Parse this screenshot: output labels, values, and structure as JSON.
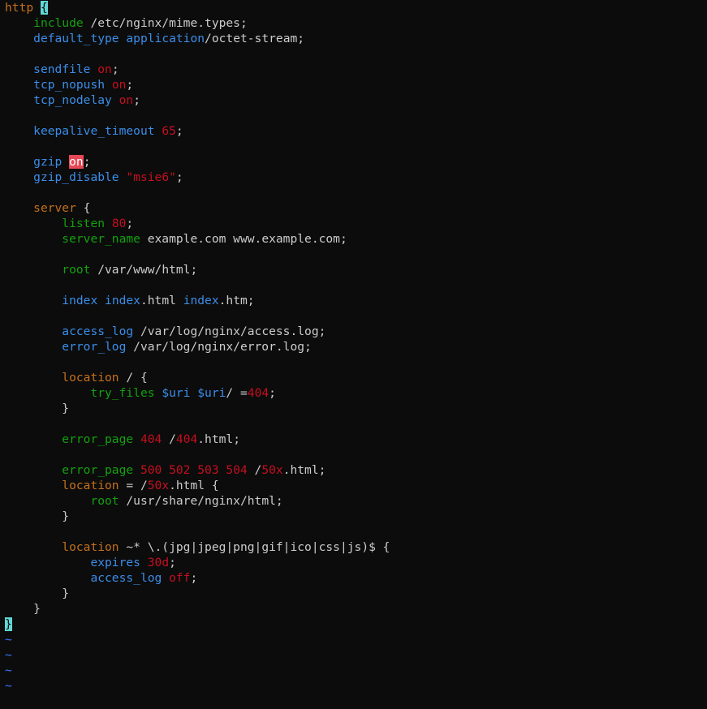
{
  "editor": {
    "lines": [
      [
        {
          "t": "http",
          "c": "block"
        },
        {
          "t": " ",
          "c": "plain"
        },
        {
          "t": "{",
          "c": "cursor"
        }
      ],
      [
        {
          "t": "    ",
          "c": "plain"
        },
        {
          "t": "include",
          "c": "green"
        },
        {
          "t": " /etc/nginx/mime.types;",
          "c": "plain"
        }
      ],
      [
        {
          "t": "    ",
          "c": "plain"
        },
        {
          "t": "default_type",
          "c": "blue"
        },
        {
          "t": " ",
          "c": "plain"
        },
        {
          "t": "application",
          "c": "blue"
        },
        {
          "t": "/octet-stream;",
          "c": "plain"
        }
      ],
      [],
      [
        {
          "t": "    ",
          "c": "plain"
        },
        {
          "t": "sendfile",
          "c": "blue"
        },
        {
          "t": " ",
          "c": "plain"
        },
        {
          "t": "on",
          "c": "red"
        },
        {
          "t": ";",
          "c": "plain"
        }
      ],
      [
        {
          "t": "    ",
          "c": "plain"
        },
        {
          "t": "tcp_nopush",
          "c": "blue"
        },
        {
          "t": " ",
          "c": "plain"
        },
        {
          "t": "on",
          "c": "red"
        },
        {
          "t": ";",
          "c": "plain"
        }
      ],
      [
        {
          "t": "    ",
          "c": "plain"
        },
        {
          "t": "tcp_nodelay",
          "c": "blue"
        },
        {
          "t": " ",
          "c": "plain"
        },
        {
          "t": "on",
          "c": "red"
        },
        {
          "t": ";",
          "c": "plain"
        }
      ],
      [],
      [
        {
          "t": "    ",
          "c": "plain"
        },
        {
          "t": "keepalive_timeout",
          "c": "blue"
        },
        {
          "t": " ",
          "c": "plain"
        },
        {
          "t": "65",
          "c": "red"
        },
        {
          "t": ";",
          "c": "plain"
        }
      ],
      [],
      [
        {
          "t": "    ",
          "c": "plain"
        },
        {
          "t": "gzip",
          "c": "blue"
        },
        {
          "t": " ",
          "c": "plain"
        },
        {
          "t": "on",
          "c": "match"
        },
        {
          "t": ";",
          "c": "plain"
        }
      ],
      [
        {
          "t": "    ",
          "c": "plain"
        },
        {
          "t": "gzip_disable",
          "c": "blue"
        },
        {
          "t": " ",
          "c": "plain"
        },
        {
          "t": "\"msie6\"",
          "c": "red"
        },
        {
          "t": ";",
          "c": "plain"
        }
      ],
      [],
      [
        {
          "t": "    ",
          "c": "plain"
        },
        {
          "t": "server",
          "c": "block"
        },
        {
          "t": " {",
          "c": "plain"
        }
      ],
      [
        {
          "t": "        ",
          "c": "plain"
        },
        {
          "t": "listen",
          "c": "green"
        },
        {
          "t": " ",
          "c": "plain"
        },
        {
          "t": "80",
          "c": "red"
        },
        {
          "t": ";",
          "c": "plain"
        }
      ],
      [
        {
          "t": "        ",
          "c": "plain"
        },
        {
          "t": "server_name",
          "c": "green"
        },
        {
          "t": " example.com www.example.com;",
          "c": "plain"
        }
      ],
      [],
      [
        {
          "t": "        ",
          "c": "plain"
        },
        {
          "t": "root",
          "c": "green"
        },
        {
          "t": " /var/www/html;",
          "c": "plain"
        }
      ],
      [],
      [
        {
          "t": "        ",
          "c": "plain"
        },
        {
          "t": "index",
          "c": "blue"
        },
        {
          "t": " ",
          "c": "plain"
        },
        {
          "t": "index",
          "c": "blue"
        },
        {
          "t": ".html ",
          "c": "plain"
        },
        {
          "t": "index",
          "c": "blue"
        },
        {
          "t": ".htm;",
          "c": "plain"
        }
      ],
      [],
      [
        {
          "t": "        ",
          "c": "plain"
        },
        {
          "t": "access_log",
          "c": "blue"
        },
        {
          "t": " /var/log/nginx/access.log;",
          "c": "plain"
        }
      ],
      [
        {
          "t": "        ",
          "c": "plain"
        },
        {
          "t": "error_log",
          "c": "blue"
        },
        {
          "t": " /var/log/nginx/error.log;",
          "c": "plain"
        }
      ],
      [],
      [
        {
          "t": "        ",
          "c": "plain"
        },
        {
          "t": "location",
          "c": "block"
        },
        {
          "t": " / {",
          "c": "plain"
        }
      ],
      [
        {
          "t": "            ",
          "c": "plain"
        },
        {
          "t": "try_files",
          "c": "green"
        },
        {
          "t": " ",
          "c": "plain"
        },
        {
          "t": "$uri",
          "c": "blue"
        },
        {
          "t": " ",
          "c": "plain"
        },
        {
          "t": "$uri",
          "c": "blue"
        },
        {
          "t": "/ =",
          "c": "plain"
        },
        {
          "t": "404",
          "c": "red"
        },
        {
          "t": ";",
          "c": "plain"
        }
      ],
      [
        {
          "t": "        }",
          "c": "plain"
        }
      ],
      [],
      [
        {
          "t": "        ",
          "c": "plain"
        },
        {
          "t": "error_page",
          "c": "green"
        },
        {
          "t": " ",
          "c": "plain"
        },
        {
          "t": "404",
          "c": "red"
        },
        {
          "t": " /",
          "c": "plain"
        },
        {
          "t": "404",
          "c": "red"
        },
        {
          "t": ".html;",
          "c": "plain"
        }
      ],
      [],
      [
        {
          "t": "        ",
          "c": "plain"
        },
        {
          "t": "error_page",
          "c": "green"
        },
        {
          "t": " ",
          "c": "plain"
        },
        {
          "t": "500 502 503 504",
          "c": "red"
        },
        {
          "t": " /",
          "c": "plain"
        },
        {
          "t": "50x",
          "c": "red"
        },
        {
          "t": ".html;",
          "c": "plain"
        }
      ],
      [
        {
          "t": "        ",
          "c": "plain"
        },
        {
          "t": "location",
          "c": "block"
        },
        {
          "t": " = /",
          "c": "plain"
        },
        {
          "t": "50x",
          "c": "red"
        },
        {
          "t": ".html {",
          "c": "plain"
        }
      ],
      [
        {
          "t": "            ",
          "c": "plain"
        },
        {
          "t": "root",
          "c": "green"
        },
        {
          "t": " /usr/share/nginx/html;",
          "c": "plain"
        }
      ],
      [
        {
          "t": "        }",
          "c": "plain"
        }
      ],
      [],
      [
        {
          "t": "        ",
          "c": "plain"
        },
        {
          "t": "location",
          "c": "block"
        },
        {
          "t": " ~* \\.(jpg|jpeg|png|gif|ico|css|js)$ {",
          "c": "plain"
        }
      ],
      [
        {
          "t": "            ",
          "c": "plain"
        },
        {
          "t": "expires",
          "c": "blue"
        },
        {
          "t": " ",
          "c": "plain"
        },
        {
          "t": "30d",
          "c": "red"
        },
        {
          "t": ";",
          "c": "plain"
        }
      ],
      [
        {
          "t": "            ",
          "c": "plain"
        },
        {
          "t": "access_log",
          "c": "blue"
        },
        {
          "t": " ",
          "c": "plain"
        },
        {
          "t": "off",
          "c": "red"
        },
        {
          "t": ";",
          "c": "plain"
        }
      ],
      [
        {
          "t": "        }",
          "c": "plain"
        }
      ],
      [
        {
          "t": "    }",
          "c": "plain"
        }
      ],
      [
        {
          "t": "}",
          "c": "cursor"
        }
      ],
      [
        {
          "t": "~",
          "c": "tilde"
        }
      ],
      [
        {
          "t": "~",
          "c": "tilde"
        }
      ],
      [
        {
          "t": "~",
          "c": "tilde"
        }
      ],
      [
        {
          "t": "~",
          "c": "tilde"
        }
      ]
    ]
  },
  "colors": {
    "background": "#0c0c0c",
    "plain": "#cccccc",
    "block_keyword": "#c4711d",
    "directive_green": "#13a10e",
    "directive_blue": "#3b8eea",
    "value_red": "#c50f1f",
    "search_match_bg": "#e74856",
    "matching_brace_bg": "#61d6d6",
    "empty_line_tilde": "#3b78ff"
  }
}
